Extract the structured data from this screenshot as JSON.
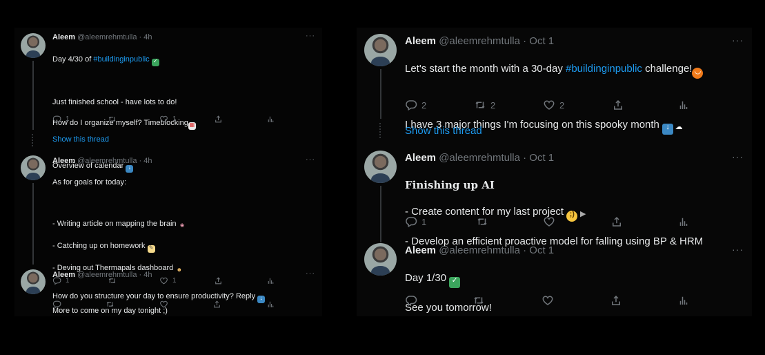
{
  "left": {
    "tweets": [
      {
        "name": "Aleem",
        "handle": "@aleemrehmtulla · 4h",
        "line1_prefix": "Day 4/30 of ",
        "line1_link": "#buildinginpublic",
        "line2": "Just finished school - have lots to do!",
        "line3": "How do I organize myself? Timeblocking",
        "line4": "Overview of calendar",
        "reply_count": "1",
        "like_count": "1"
      },
      {
        "name": "Aleem",
        "handle": "@aleemrehmtulla · 4h",
        "line1": "As for goals for today:",
        "line2": "- Writing article on mapping the brain",
        "line3": "- Catching up on homework",
        "line4": "- Deving out Thermapals dashboard",
        "line5": "More to come on my day tonight ;)",
        "reply_count": "1",
        "like_count": "1"
      },
      {
        "name": "Aleem",
        "handle": "@aleemrehmtulla · 4h",
        "line1": "How do you structure your day to ensure productivity? Reply"
      }
    ],
    "show_thread": "Show this thread"
  },
  "right": {
    "tweets": [
      {
        "name": "Aleem",
        "handle": "@aleemrehmtulla · Oct 1",
        "line1_prefix": "Let's start the month with a 30-day ",
        "line1_link": "#buildinginpublic",
        "line1_suffix": " challenge!",
        "line2": "I have 3 major things I'm focusing on this spooky month",
        "reply_count": "2",
        "retweet_count": "2",
        "like_count": "2"
      },
      {
        "name": "Aleem",
        "handle": "@aleemrehmtulla · Oct 1",
        "title": "Finishing up AI",
        "line2": "- Create content for my last project",
        "line3": "- Develop an efficient proactive model for falling using BP & HRM",
        "reply_count": "1"
      },
      {
        "name": "Aleem",
        "handle": "@aleemrehmtulla · Oct 1",
        "line1": "Day 1/30",
        "line2": "See you tomorrow!"
      }
    ],
    "show_thread": "Show this thread"
  },
  "more_glyph": "···",
  "colors": {
    "link": "#1d9bf0",
    "muted": "#71767b",
    "text": "#e7e9ea",
    "background": "#000000"
  },
  "icons": [
    "reply-icon",
    "retweet-icon",
    "like-icon",
    "share-icon",
    "analytics-icon"
  ]
}
